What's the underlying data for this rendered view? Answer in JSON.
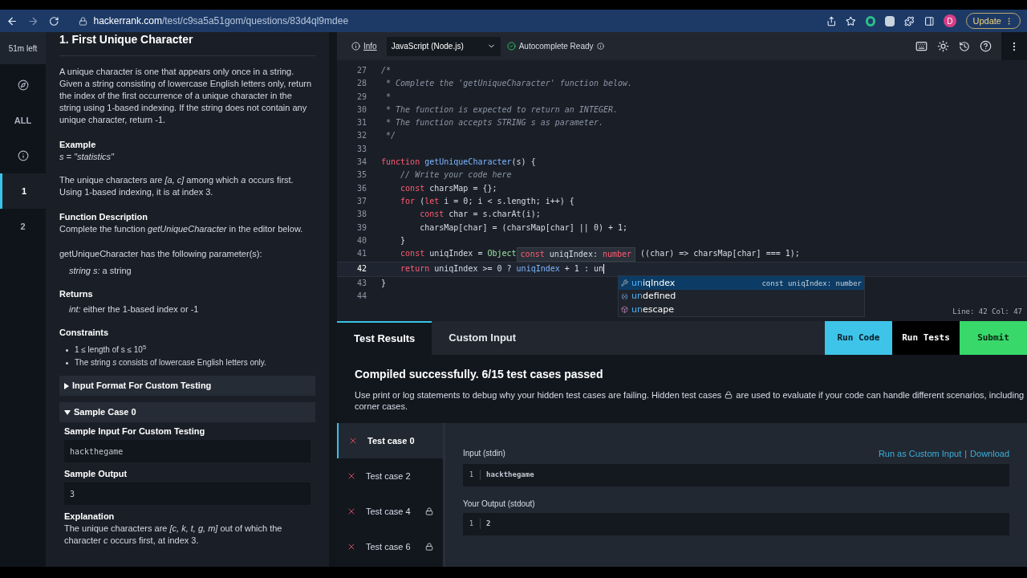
{
  "browser": {
    "url_host": "hackerrank.com",
    "url_path": "/test/c9sa5a51gom/questions/83d4ql9mdee",
    "avatar": "D",
    "update_label": "Update"
  },
  "nav": {
    "timer": "51m left",
    "items": [
      {
        "kind": "compass",
        "selected": false
      },
      {
        "kind": "text",
        "label": "ALL",
        "selected": false
      },
      {
        "kind": "info",
        "selected": false
      },
      {
        "kind": "text",
        "label": "1",
        "selected": true
      },
      {
        "kind": "text",
        "label": "2",
        "selected": false
      }
    ]
  },
  "problem": {
    "title": "1. First Unique Character",
    "blocks": [
      {
        "kind": "para",
        "text": "A unique character is one that appears only once in a string. Given a string consisting of lowercase English letters only, return the index of the first occurrence of a unique character in the string using 1-based indexing. If the string does not contain any unique character, return -1."
      },
      {
        "kind": "heading",
        "text": "Example"
      },
      {
        "kind": "italic",
        "text": "s = \"statistics\""
      },
      {
        "kind": "gap"
      },
      {
        "kind": "para",
        "text": "The unique characters are *[a, c]* among which *a* occurs first. Using 1-based indexing, it is at index 3."
      },
      {
        "kind": "heading",
        "text": "Function Description"
      },
      {
        "kind": "para",
        "text": "Complete the function *getUniqueCharacter* in the editor below."
      },
      {
        "kind": "gap"
      },
      {
        "kind": "para",
        "text": "getUniqueCharacter has the following parameter(s):"
      },
      {
        "kind": "indent",
        "text": "*string s:*  a string"
      },
      {
        "kind": "heading",
        "text": "Returns"
      },
      {
        "kind": "indent",
        "text": "*int:* either the 1-based index or -1"
      },
      {
        "kind": "heading",
        "text": "Constraints"
      },
      {
        "kind": "bullets",
        "items": [
          "1 ≤ length of s ≤ 10$^{5}$",
          "The string *s* consists of lowercase English letters only."
        ]
      },
      {
        "kind": "accordion",
        "label": "Input Format For Custom Testing",
        "expanded": false
      },
      {
        "kind": "accordion",
        "label": "Sample Case 0",
        "expanded": true
      },
      {
        "kind": "subheading",
        "text": "Sample Input For Custom Testing"
      },
      {
        "kind": "code",
        "text": "hackthegame"
      },
      {
        "kind": "subheading",
        "text": "Sample Output"
      },
      {
        "kind": "code",
        "text": "3"
      },
      {
        "kind": "subheading",
        "text": "Explanation"
      },
      {
        "kind": "subpara",
        "text": "The unique characters are *[c, k, t, g, m]* out of which the character *c* occurs first, at index 3."
      }
    ]
  },
  "editor": {
    "info_label": "Info",
    "language": "JavaScript (Node.js)",
    "autocomplete_status": "Autocomplete Ready",
    "status": "Line: 42 Col: 47",
    "lines": [
      {
        "n": "27",
        "tokens": [
          {
            "kind": "comment",
            "text": "/*"
          }
        ]
      },
      {
        "n": "28",
        "tokens": [
          {
            "kind": "comment",
            "text": " * Complete the 'getUniqueCharacter' function below."
          }
        ]
      },
      {
        "n": "29",
        "tokens": [
          {
            "kind": "comment",
            "text": " *"
          }
        ]
      },
      {
        "n": "30",
        "tokens": [
          {
            "kind": "comment",
            "text": " * The function is expected to return an INTEGER."
          }
        ]
      },
      {
        "n": "31",
        "tokens": [
          {
            "kind": "comment",
            "text": " * The function accepts STRING s as parameter."
          }
        ]
      },
      {
        "n": "32",
        "tokens": [
          {
            "kind": "comment",
            "text": " */"
          }
        ]
      },
      {
        "n": "33"
      },
      {
        "n": "34",
        "tokens": [
          {
            "kind": "keyword",
            "text": "function "
          },
          {
            "kind": "function",
            "text": "getUniqueCharacter"
          },
          {
            "kind": "plain",
            "text": "(s) {"
          }
        ]
      },
      {
        "n": "35",
        "tokens": [
          {
            "kind": "comment",
            "text": "    // Write your code here"
          }
        ]
      },
      {
        "n": "36",
        "tokens": [
          {
            "kind": "keyword",
            "text": "    const"
          },
          {
            "kind": "plain",
            "text": " charsMap = {};"
          }
        ]
      },
      {
        "n": "37",
        "tokens": [
          {
            "kind": "keyword",
            "text": "    for"
          },
          {
            "kind": "plain",
            "text": " ("
          },
          {
            "kind": "keyword",
            "text": "let"
          },
          {
            "kind": "plain",
            "text": " i = 0; i < s.length; i++) {"
          }
        ]
      },
      {
        "n": "38",
        "tokens": [
          {
            "kind": "keyword",
            "text": "        const"
          },
          {
            "kind": "plain",
            "text": " char = s.charAt(i);"
          }
        ]
      },
      {
        "n": "39",
        "tokens": [
          {
            "kind": "plain",
            "text": "        charsMap[char] = (charsMap[char] || 0) + 1;"
          }
        ]
      },
      {
        "n": "40",
        "tokens": [
          {
            "kind": "plain",
            "text": "    }"
          }
        ]
      },
      {
        "n": "41",
        "tokens": [
          {
            "kind": "keyword",
            "text": "    const"
          },
          {
            "kind": "plain",
            "text": " uniqIndex = "
          },
          {
            "kind": "type",
            "text": "Object"
          }
        ],
        "tooltip": [
          {
            "kind": "keyword",
            "text": "const"
          },
          {
            "kind": "plain",
            "text": " uniqIndex: "
          },
          {
            "kind": "keyword",
            "text": "number"
          }
        ],
        "rest": [
          {
            "kind": "plain",
            "text": " ((char) => charsMap[char] === 1);"
          }
        ]
      },
      {
        "n": "42",
        "current": true,
        "tokens": [
          {
            "kind": "keyword",
            "text": "    return"
          },
          {
            "kind": "plain",
            "text": " uniqIndex >= 0 ? "
          },
          {
            "kind": "highlight",
            "text": "uniqIndex"
          },
          {
            "kind": "plain",
            "text": " + 1 : un"
          }
        ]
      },
      {
        "n": "43",
        "tokens": [
          {
            "kind": "plain",
            "text": "}"
          }
        ]
      },
      {
        "n": "44"
      }
    ],
    "suggestions": [
      {
        "kind": "wrench",
        "label": "**un**iqIndex",
        "detail": "const uniqIndex: number",
        "selected": true
      },
      {
        "kind": "variable",
        "label": "**un**defined",
        "selected": false
      },
      {
        "kind": "cube",
        "label": "**un**escape",
        "selected": false
      }
    ]
  },
  "results": {
    "tabs": [
      {
        "label": "Test Results",
        "selected": true
      },
      {
        "label": "Custom Input",
        "selected": false
      }
    ],
    "buttons": [
      {
        "kind": "run",
        "label": "Run Code"
      },
      {
        "kind": "tests",
        "label": "Run Tests"
      },
      {
        "kind": "submit",
        "label": "Submit"
      }
    ],
    "headline": "Compiled successfully. 6/15 test cases passed",
    "note_before": "Use print or log statements to debug why your hidden test cases are failing. Hidden test cases",
    "note_after": "are used to evaluate if your code can handle different scenarios, including",
    "note_end": "corner cases.",
    "test_cases": [
      {
        "label": "Test case 0",
        "passed": false,
        "locked": false,
        "selected": true
      },
      {
        "label": "Test case 2",
        "passed": false,
        "locked": false,
        "selected": false
      },
      {
        "label": "Test case 4",
        "passed": false,
        "locked": true,
        "selected": false
      },
      {
        "label": "Test case 6",
        "passed": false,
        "locked": true,
        "selected": false
      }
    ],
    "input_label": "Input (stdin)",
    "links": [
      "Run as Custom Input",
      "Download"
    ],
    "link_separator": "|",
    "input": [
      {
        "n": "1",
        "text": "hackthegame"
      }
    ],
    "output_label": "Your Output (stdout)",
    "output": [
      {
        "n": "1",
        "text": "2"
      }
    ]
  }
}
